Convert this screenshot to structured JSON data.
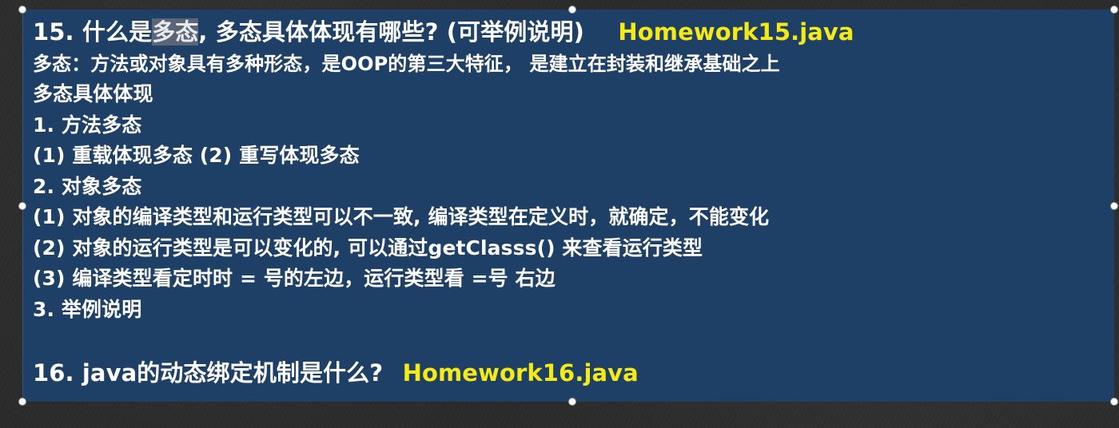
{
  "q15": {
    "number": "15.",
    "highlight": "多态",
    "question_rest": ", 多态具体体现有哪些? (可举例说明)",
    "question_prefix": "什么是",
    "file": "Homework15.java"
  },
  "body": {
    "definition": "多态：方法或对象具有多种形态，是OOP的第三大特征， 是建立在封装和继承基础之上",
    "subtitle": "多态具体体现",
    "method_heading": "1. 方法多态",
    "method_detail": "(1) 重载体现多态 (2) 重写体现多态",
    "object_heading": "2. 对象多态",
    "object_point1": "(1) 对象的编译类型和运行类型可以不一致, 编译类型在定义时，就确定，不能变化",
    "object_point2": "(2) 对象的运行类型是可以变化的, 可以通过getClasss() 来查看运行类型",
    "object_point3": "(3) 编译类型看定时时 = 号的左边，运行类型看 =号 右边",
    "example_heading": "3. 举例说明"
  },
  "q16": {
    "question": "16. java的动态绑定机制是什么?",
    "file": "Homework16.java"
  },
  "colors": {
    "slide_bg": "#1e3f66",
    "text": "#ffffff",
    "file_accent": "#f5ea15",
    "selection": "#5a6577",
    "canvas": "#2b2b2b"
  }
}
